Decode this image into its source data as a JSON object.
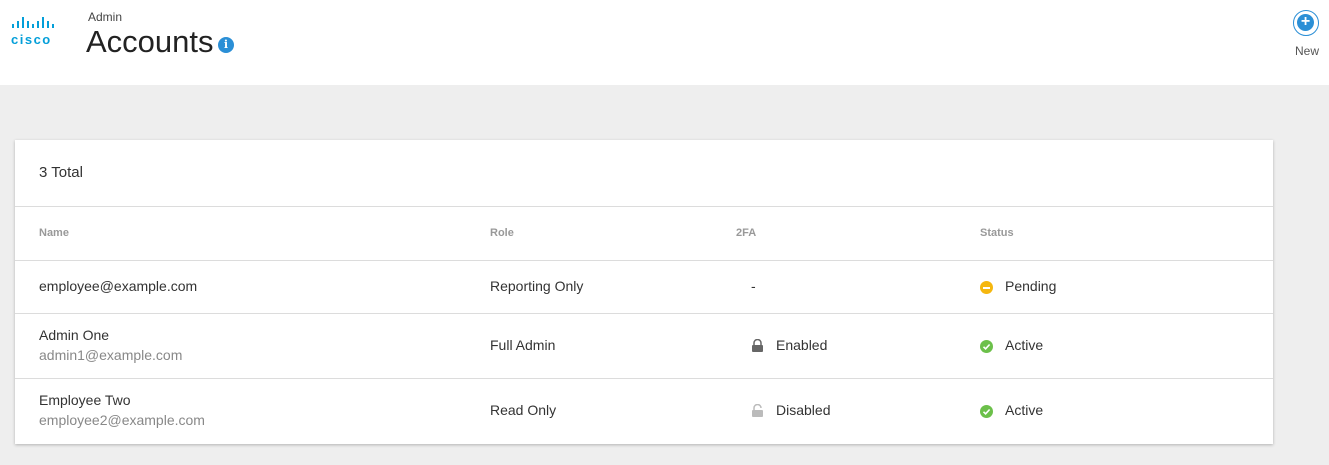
{
  "header": {
    "logo_text": "cisco",
    "section": "Admin",
    "title": "Accounts",
    "info_glyph": "i",
    "new_label": "New"
  },
  "table": {
    "total": "3 Total",
    "columns": [
      "Name",
      "Role",
      "2FA",
      "Status"
    ],
    "rows": [
      {
        "name": "employee@example.com",
        "email": "",
        "role": "Reporting Only",
        "twofa": "-",
        "twofa_icon": "",
        "status": "Pending",
        "status_icon": "pending-icon"
      },
      {
        "name": "Admin One",
        "email": "admin1@example.com",
        "role": "Full Admin",
        "twofa": "Enabled",
        "twofa_icon": "lock-closed-icon",
        "status": "Active",
        "status_icon": "check-icon"
      },
      {
        "name": "Employee Two",
        "email": "employee2@example.com",
        "role": "Read Only",
        "twofa": "Disabled",
        "twofa_icon": "lock-open-icon",
        "status": "Active",
        "status_icon": "check-icon"
      }
    ]
  },
  "colors": {
    "accent": "#2b8fd6",
    "logo": "#049fd9",
    "pending": "#f5b70f",
    "active": "#6cc04a"
  }
}
